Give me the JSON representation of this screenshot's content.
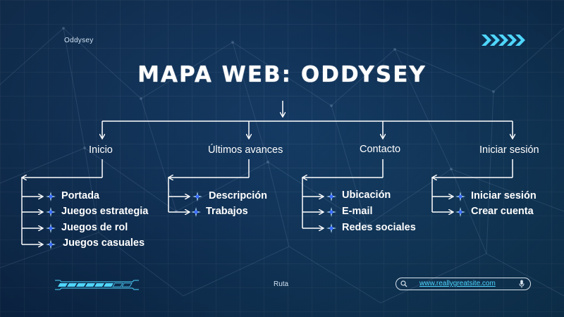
{
  "brand": "Oddysey",
  "title": "MAPA WEB: ODDYSEY",
  "footer_label": "Ruta",
  "search": {
    "url": "www.reallygreatsite.com"
  },
  "colors": {
    "accent": "#4fd6ff",
    "line": "#ffffff",
    "background": "#123a62"
  },
  "icons": [
    "chevrons-right-icon",
    "sparkle-icon",
    "search-icon",
    "microphone-icon",
    "progress-bar"
  ],
  "sections": [
    {
      "label": "Inicio",
      "items": [
        "Portada",
        "Juegos estrategia",
        "Juegos de rol",
        "Juegos casuales"
      ]
    },
    {
      "label": "Últimos avances",
      "items": [
        "Descripción",
        "Trabajos"
      ]
    },
    {
      "label": "Contacto",
      "items": [
        "Ubicación",
        "E-mail",
        "Redes sociales"
      ]
    },
    {
      "label": "Iniciar sesión",
      "items": [
        "Iniciar sesión",
        "Crear cuenta"
      ]
    }
  ]
}
